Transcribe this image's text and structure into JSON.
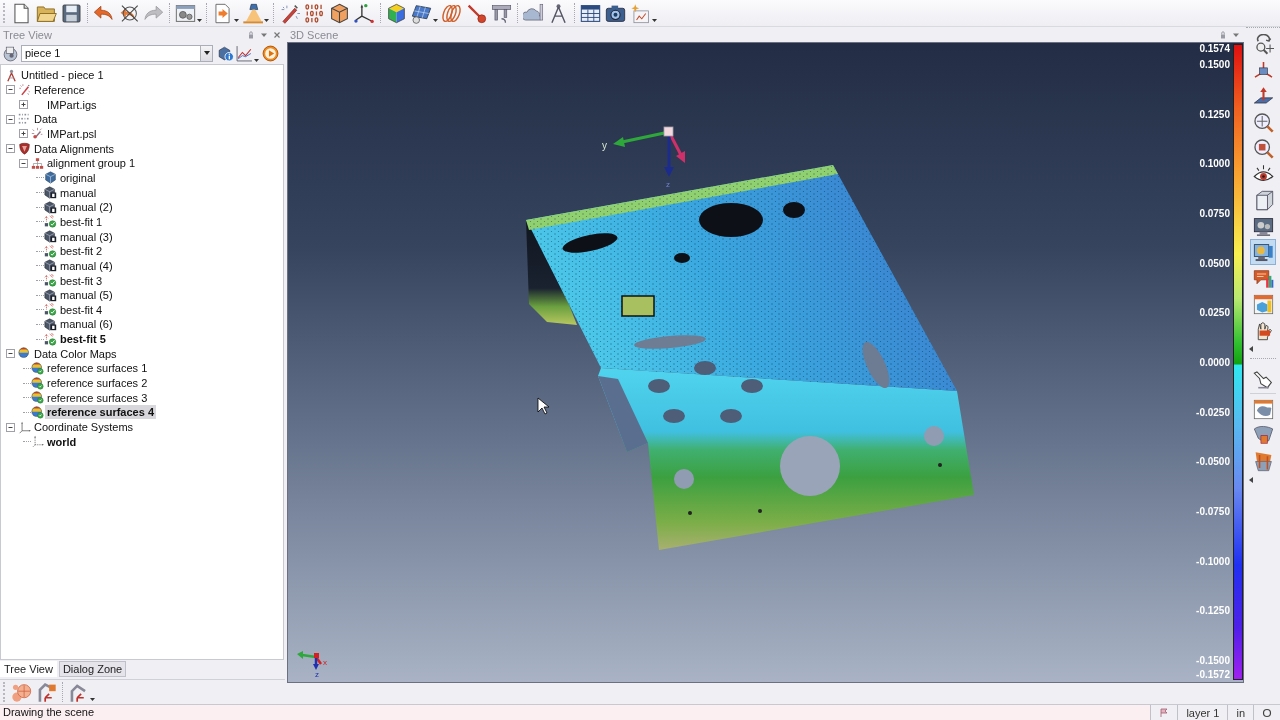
{
  "tree_panel": {
    "title": "Tree View",
    "selector": {
      "value": "piece 1"
    },
    "root": {
      "label": "Untitled - piece 1",
      "kind": "root",
      "selected": false,
      "current": false,
      "children": [
        {
          "label": "Reference",
          "kind": "reference",
          "expanded": true,
          "selected": false,
          "current": false,
          "children": [
            {
              "label": "IMPart.igs",
              "kind": "cad",
              "expanded": false,
              "selected": false,
              "current": false
            }
          ]
        },
        {
          "label": "Data",
          "kind": "data",
          "expanded": true,
          "selected": false,
          "current": false,
          "children": [
            {
              "label": "IMPart.psl",
              "kind": "cloud",
              "expanded": false,
              "selected": false,
              "current": false
            }
          ]
        },
        {
          "label": "Data Alignments",
          "kind": "alignments",
          "expanded": true,
          "selected": false,
          "current": false,
          "children": [
            {
              "label": "alignment group 1",
              "kind": "group",
              "expanded": true,
              "selected": false,
              "current": false,
              "children": [
                {
                  "label": "original",
                  "kind": "original",
                  "selected": false,
                  "current": false
                },
                {
                  "label": "manual",
                  "kind": "manual",
                  "selected": false,
                  "current": false
                },
                {
                  "label": "manual (2)",
                  "kind": "manual",
                  "selected": false,
                  "current": false
                },
                {
                  "label": "best-fit 1",
                  "kind": "bestfit",
                  "selected": false,
                  "current": false
                },
                {
                  "label": "manual (3)",
                  "kind": "manual",
                  "selected": false,
                  "current": false
                },
                {
                  "label": "best-fit 2",
                  "kind": "bestfit",
                  "selected": false,
                  "current": false
                },
                {
                  "label": "manual (4)",
                  "kind": "manual",
                  "selected": false,
                  "current": false
                },
                {
                  "label": "best-fit 3",
                  "kind": "bestfit",
                  "selected": false,
                  "current": false
                },
                {
                  "label": "manual (5)",
                  "kind": "manual",
                  "selected": false,
                  "current": false
                },
                {
                  "label": "best-fit 4",
                  "kind": "bestfit",
                  "selected": false,
                  "current": false
                },
                {
                  "label": "manual (6)",
                  "kind": "manual",
                  "selected": false,
                  "current": false
                },
                {
                  "label": "best-fit 5",
                  "kind": "bestfit",
                  "selected": false,
                  "current": true
                }
              ]
            }
          ]
        },
        {
          "label": "Data Color Maps",
          "kind": "colormaps",
          "expanded": true,
          "selected": false,
          "current": false,
          "children": [
            {
              "label": "reference surfaces 1",
              "kind": "colormap",
              "selected": false,
              "current": false
            },
            {
              "label": "reference surfaces 2",
              "kind": "colormap",
              "selected": false,
              "current": false
            },
            {
              "label": "reference surfaces 3",
              "kind": "colormap",
              "selected": false,
              "current": false
            },
            {
              "label": "reference surfaces 4",
              "kind": "colormap",
              "selected": true,
              "current": true
            }
          ]
        },
        {
          "label": "Coordinate Systems",
          "kind": "coordsys",
          "expanded": true,
          "selected": false,
          "current": false,
          "children": [
            {
              "label": "world",
              "kind": "frame",
              "selected": false,
              "current": true
            }
          ]
        }
      ]
    }
  },
  "panel_tabs": [
    {
      "label": "Tree View",
      "selected": true
    },
    {
      "label": "Dialog Zone",
      "selected": false
    }
  ],
  "scene": {
    "title": "3D Scene",
    "gizmo_labels": [
      "y",
      "z"
    ],
    "triad_labels": [
      "x",
      "z"
    ],
    "legend": {
      "ticks": [
        "0.1574",
        "0.1500",
        "0.1250",
        "0.1000",
        "0.0750",
        "0.0500",
        "0.0250",
        "0.0000",
        "-0.0250",
        "-0.0500",
        "-0.0750",
        "-0.1000",
        "-0.1250",
        "-0.1500",
        "-0.1572"
      ]
    }
  },
  "right_toolbar": {
    "buttons": [
      {
        "selected": false
      },
      {
        "selected": false
      },
      {
        "selected": false
      },
      {
        "selected": false
      },
      {
        "selected": false
      },
      {
        "selected": false
      },
      {
        "selected": false
      },
      {
        "selected": false
      },
      {
        "selected": true
      },
      {
        "selected": false
      },
      {
        "selected": false
      },
      {
        "selected": false
      },
      {
        "selected": false
      },
      {
        "selected": false
      },
      {
        "selected": false
      },
      {
        "selected": false
      }
    ]
  },
  "status_bar": {
    "message": "Drawing the scene",
    "layer": "layer 1",
    "units": "in"
  }
}
